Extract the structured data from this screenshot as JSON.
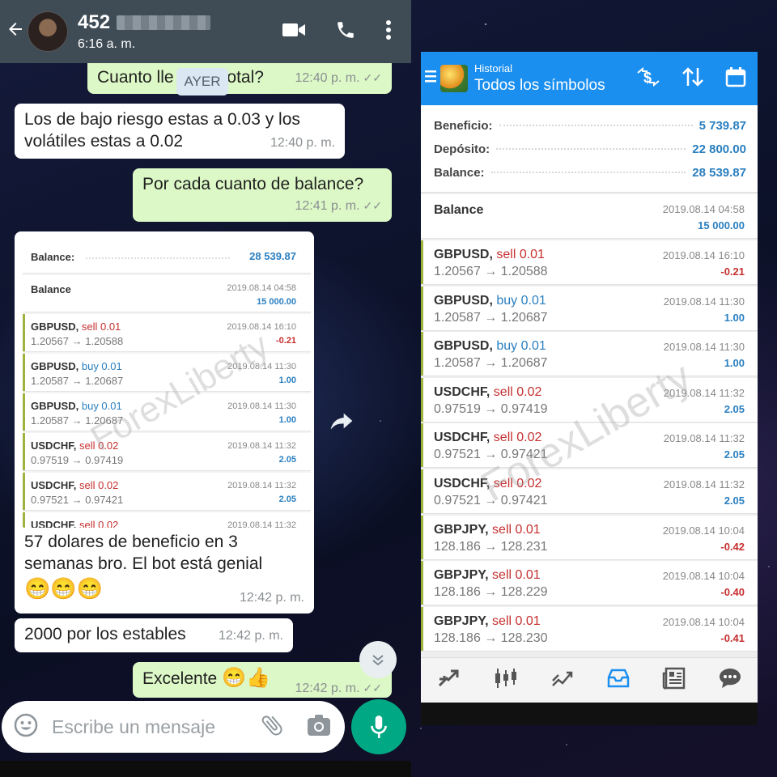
{
  "whatsapp": {
    "header": {
      "contact_name": "452",
      "last_seen": "6:16 a. m."
    },
    "day_chip": "AYER",
    "messages": [
      {
        "text": "Cuanto lle",
        "text_after": "total?",
        "time": "12:40 p. m."
      },
      {
        "text_line1": "Los de bajo riesgo estas a 0.03 y los",
        "text_line2": "volátiles estas a 0.02",
        "time": "12:40 p. m."
      },
      {
        "text": "Por cada cuanto de balance?",
        "time": "12:41 p. m."
      },
      {
        "caption_line1": "57 dolares de beneficio en 3",
        "caption_line2": "semanas bro. El bot está genial",
        "emoji": "😁😁😁",
        "time": "12:42 p. m."
      },
      {
        "text": "2000 por los estables",
        "time": "12:42 p. m."
      },
      {
        "text": "Excelente",
        "emoji": "😁👍",
        "time": "12:42 p. m."
      }
    ],
    "embedded": {
      "balance_label": "Balance:",
      "balance_value": "28 539.87",
      "balance_row": {
        "label": "Balance",
        "date": "2019.08.14 04:58",
        "amount": "15 000.00"
      },
      "trades": [
        {
          "symbol": "GBPUSD,",
          "side": "sell 0.01",
          "prices": "1.20567 → 1.20588",
          "date": "2019.08.14 16:10",
          "profit": "-0.21"
        },
        {
          "symbol": "GBPUSD,",
          "side": "buy 0.01",
          "prices": "1.20587 → 1.20687",
          "date": "2019.08.14 11:30",
          "profit": "1.00"
        },
        {
          "symbol": "GBPUSD,",
          "side": "buy 0.01",
          "prices": "1.20587 → 1.20687",
          "date": "2019.08.14 11:30",
          "profit": "1.00"
        },
        {
          "symbol": "USDCHF,",
          "side": "sell 0.02",
          "prices": "0.97519 → 0.97419",
          "date": "2019.08.14 11:32",
          "profit": "2.05"
        },
        {
          "symbol": "USDCHF,",
          "side": "sell 0.02",
          "prices": "0.97521 → 0.97421",
          "date": "2019.08.14 11:32",
          "profit": "2.05"
        },
        {
          "symbol": "USDCHF,",
          "side": "sell 0.02",
          "prices": "",
          "date": "2019.08.14 11:32",
          "profit": ""
        }
      ]
    },
    "watermark": "ForexLiberty",
    "composer_placeholder": "Escribe un mensaje"
  },
  "metatrader": {
    "header": {
      "subtitle": "Historial",
      "title": "Todos los símbolos"
    },
    "summary": [
      {
        "label": "Beneficio:",
        "value": "5 739.87"
      },
      {
        "label": "Depósito:",
        "value": "22 800.00"
      },
      {
        "label": "Balance:",
        "value": "28 539.87"
      }
    ],
    "balance_row": {
      "label": "Balance",
      "date": "2019.08.14 04:58",
      "amount": "15 000.00"
    },
    "trades": [
      {
        "symbol": "GBPUSD,",
        "side": "sell 0.01",
        "prices": "1.20567 → 1.20588",
        "date": "2019.08.14 16:10",
        "profit": "-0.21"
      },
      {
        "symbol": "GBPUSD,",
        "side": "buy 0.01",
        "prices": "1.20587 → 1.20687",
        "date": "2019.08.14 11:30",
        "profit": "1.00"
      },
      {
        "symbol": "GBPUSD,",
        "side": "buy 0.01",
        "prices": "1.20587 → 1.20687",
        "date": "2019.08.14 11:30",
        "profit": "1.00"
      },
      {
        "symbol": "USDCHF,",
        "side": "sell 0.02",
        "prices": "0.97519 → 0.97419",
        "date": "2019.08.14 11:32",
        "profit": "2.05"
      },
      {
        "symbol": "USDCHF,",
        "side": "sell 0.02",
        "prices": "0.97521 → 0.97421",
        "date": "2019.08.14 11:32",
        "profit": "2.05"
      },
      {
        "symbol": "USDCHF,",
        "side": "sell 0.02",
        "prices": "0.97521 → 0.97421",
        "date": "2019.08.14 11:32",
        "profit": "2.05"
      },
      {
        "symbol": "GBPJPY,",
        "side": "sell 0.01",
        "prices": "128.186 → 128.231",
        "date": "2019.08.14 10:04",
        "profit": "-0.42"
      },
      {
        "symbol": "GBPJPY,",
        "side": "sell 0.01",
        "prices": "128.186 → 128.229",
        "date": "2019.08.14 10:04",
        "profit": "-0.40"
      },
      {
        "symbol": "GBPJPY,",
        "side": "sell 0.01",
        "prices": "128.186 → 128.230",
        "date": "2019.08.14 10:04",
        "profit": "-0.41"
      }
    ],
    "watermark": "ForexLiberty",
    "bottom_tabs": [
      "quotes-icon",
      "chart-icon",
      "trade-icon",
      "history-icon",
      "news-icon",
      "chat-icon"
    ],
    "colors": {
      "header": "#1a8ff0",
      "buy": "#2a7fc0",
      "sell": "#c62f2f",
      "active_tab": "#1a8ff0"
    }
  }
}
